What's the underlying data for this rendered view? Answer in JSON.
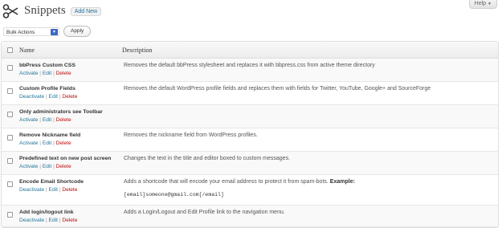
{
  "help": {
    "label": "Help"
  },
  "page": {
    "title": "Snippets",
    "add_new": "Add New"
  },
  "bulk": {
    "selected": "Bulk Actions",
    "apply": "Apply"
  },
  "table": {
    "col_name": "Name",
    "col_description": "Description",
    "rows": [
      {
        "name": "bbPress Custom CSS",
        "toggle": "Activate",
        "edit": "Edit",
        "delete": "Delete",
        "description": "Removes the default bbPress stylesheet and replaces it with bbpress.css from active theme directory"
      },
      {
        "name": "Custom Profile Fields",
        "toggle": "Deactivate",
        "edit": "Edit",
        "delete": "Delete",
        "description": "Removes the default WordPress profile fields and replaces them with fields for Twitter, YouTube, Google+ and SourceForge"
      },
      {
        "name": "Only administrators see Toolbar",
        "toggle": "Activate",
        "edit": "Edit",
        "delete": "Delete",
        "description": ""
      },
      {
        "name": "Remove Nickname field",
        "toggle": "Activate",
        "edit": "Edit",
        "delete": "Delete",
        "description": "Removes the nickname field from WordPress profiles."
      },
      {
        "name": "Predefined text on new post screen",
        "toggle": "Activate",
        "edit": "Edit",
        "delete": "Delete",
        "description": "Changes the text in the title and editor boxed to custom messages."
      },
      {
        "name": "Encode Email Shortcode",
        "toggle": "Deactivate",
        "edit": "Edit",
        "delete": "Delete",
        "description": "Adds a shortcode that will encode your email address to protect it from spam-bots.",
        "example_label": "Example:",
        "code": "[email]someone@gmail.com[/email]"
      },
      {
        "name": "Add login/logout link",
        "toggle": "Deactivate",
        "edit": "Edit",
        "delete": "Delete",
        "description": "Adds a Login/Logout and Edit Profile link to the navigation menu."
      }
    ]
  }
}
